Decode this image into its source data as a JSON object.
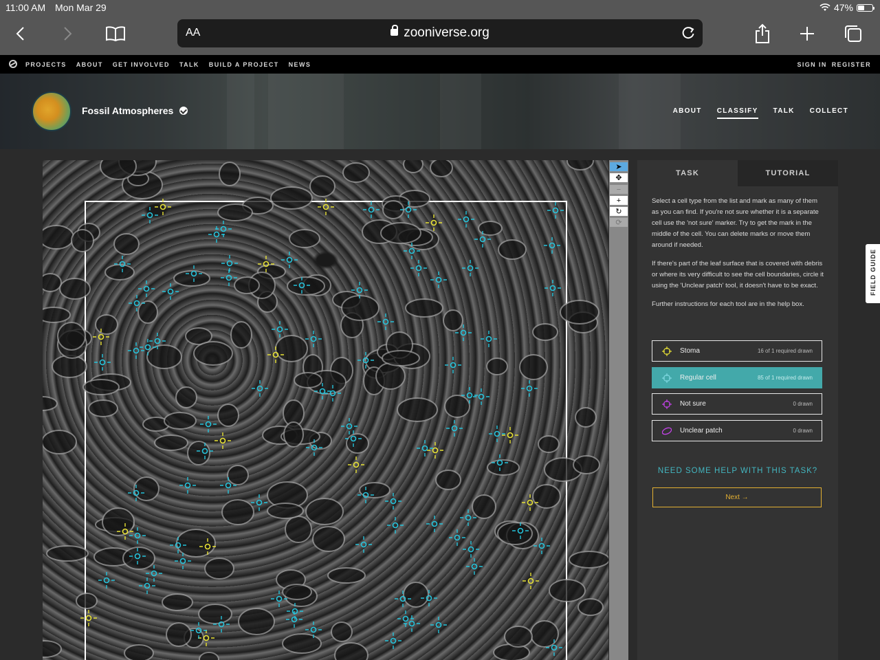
{
  "status_bar": {
    "time": "11:00 AM",
    "date": "Mon Mar 29",
    "battery": "47%",
    "battery_level": 0.47
  },
  "browser": {
    "text_size_label": "AA",
    "url": "zooniverse.org"
  },
  "site_nav": {
    "links": [
      "PROJECTS",
      "ABOUT",
      "GET INVOLVED",
      "TALK",
      "BUILD A PROJECT",
      "NEWS"
    ],
    "sign_in": "SIGN IN",
    "register": "REGISTER"
  },
  "project": {
    "title": "Fossil Atmospheres",
    "links": [
      "ABOUT",
      "CLASSIFY",
      "TALK",
      "COLLECT"
    ],
    "active_link": "CLASSIFY"
  },
  "toolbar": {
    "tools": [
      {
        "icon": "pointer-icon",
        "glyph": "➤",
        "state": "active"
      },
      {
        "icon": "move-icon",
        "glyph": "✥",
        "state": "normal"
      },
      {
        "icon": "zoom-out-icon",
        "glyph": "−",
        "state": "disabled"
      },
      {
        "icon": "zoom-in-icon",
        "glyph": "+",
        "state": "normal"
      },
      {
        "icon": "rotate-icon",
        "glyph": "↻",
        "state": "normal"
      },
      {
        "icon": "reset-icon",
        "glyph": "⟳",
        "state": "disabled"
      }
    ]
  },
  "task": {
    "tabs": [
      "TASK",
      "TUTORIAL"
    ],
    "active_tab": "TASK",
    "instructions": [
      "Select a cell type from the list and mark as many of them as you can find. If you're not sure whether it is a separate cell use the 'not sure' marker. Try to get the mark in the middle of the cell. You can delete marks or move them around if needed.",
      "If there's part of the leaf surface that is covered with debris or where its very difficult to see the cell boundaries, circle it using the 'Unclear patch' tool, it doesn't have to be exact.",
      "Further instructions for each tool are in the help box."
    ],
    "tools": [
      {
        "label": "Stoma",
        "count": "16 of 1 required drawn",
        "color": "#e8e234",
        "icon": "crosshair-icon",
        "selected": false
      },
      {
        "label": "Regular cell",
        "count": "85 of 1 required drawn",
        "color": "#7fd8e0",
        "icon": "crosshair-icon",
        "selected": true
      },
      {
        "label": "Not sure",
        "count": "0 drawn",
        "color": "#c342e8",
        "icon": "crosshair-icon",
        "selected": false
      },
      {
        "label": "Unclear patch",
        "count": "0 drawn",
        "color": "#c342e8",
        "icon": "ellipse-icon",
        "selected": false
      }
    ],
    "help_link": "NEED SOME HELP WITH THIS TASK?",
    "next_button": "Next →"
  },
  "field_guide": "FIELD GUIDE",
  "colors": {
    "stoma_mark": "#e8e234",
    "regular_mark": "#25c4dc",
    "accent": "#43a9aa",
    "next": "#e5b132"
  }
}
